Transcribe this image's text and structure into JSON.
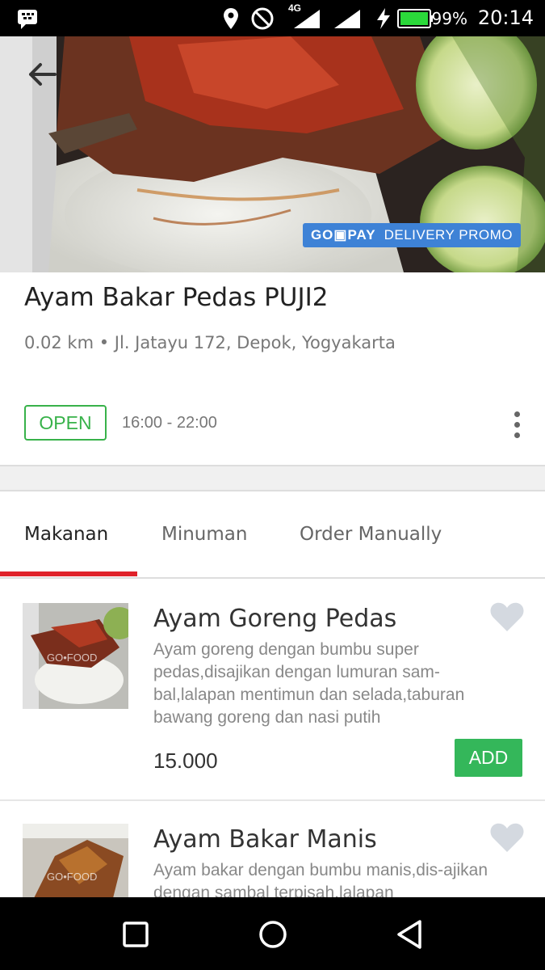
{
  "status_bar": {
    "network": "4G",
    "battery": "99%",
    "time": "20:14",
    "icons": [
      "bbm-icon",
      "location-icon",
      "do-not-disturb-icon",
      "signal-icon",
      "charging-icon",
      "battery-icon"
    ]
  },
  "restaurant": {
    "name": "Ayam Bakar Pedas PUJI2",
    "address": "0.02 km • Jl. Jatayu 172, Depok, Yogyakarta",
    "status": "OPEN",
    "hours": "16:00 - 22:00"
  },
  "promo": {
    "brand": "GO▣PAY",
    "label": "DELIVERY PROMO",
    "color": "#3e82d6"
  },
  "tabs": [
    {
      "label": "Makanan",
      "active": true
    },
    {
      "label": "Minuman",
      "active": false
    },
    {
      "label": "Order Manually",
      "active": false
    }
  ],
  "accent_color": "#e0222a",
  "open_color": "#38b24a",
  "items": [
    {
      "name": "Ayam Goreng Pedas",
      "description": "Ayam goreng dengan bumbu super pedas,disajikan dengan lumuran sam-bal,lalapan mentimun dan selada,taburan bawang goreng dan nasi putih",
      "price": "15.000",
      "add_label": "ADD",
      "watermark": "GO•FOOD"
    },
    {
      "name": "Ayam Bakar Manis",
      "description": "Ayam bakar dengan bumbu manis,dis-ajikan dengan sambal terpisah,lalapan",
      "watermark": "GO•FOOD"
    }
  ]
}
